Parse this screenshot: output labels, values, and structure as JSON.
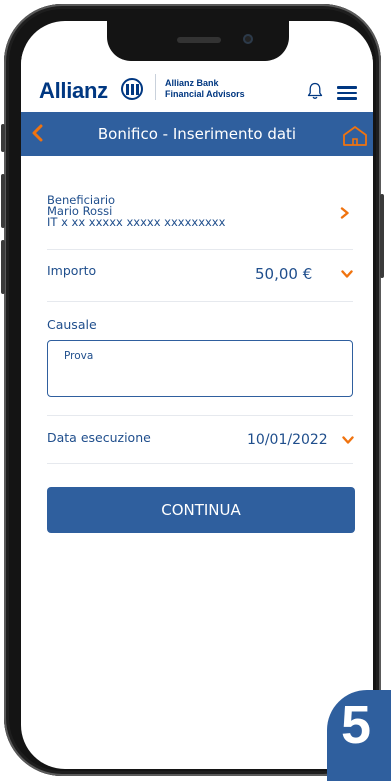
{
  "header": {
    "brand_name": "Allianz",
    "brand_line_1": "Allianz Bank",
    "brand_line_2": "Financial Advisors",
    "icons": [
      "allianz-logo-icon",
      "bell-icon",
      "hamburger-menu-icon"
    ]
  },
  "navbar": {
    "title": "Bonifico - Inserimento dati",
    "icons": [
      "back-chevron-icon",
      "home-icon"
    ]
  },
  "form": {
    "beneficiary": {
      "label": "Beneficiario",
      "name": "Mario Rossi",
      "iban": "IT x xx xxxxx xxxxx xxxxxxxxx"
    },
    "amount": {
      "label": "Importo",
      "value": "50,00 €"
    },
    "reason": {
      "label": "Causale",
      "value": "Prova"
    },
    "execution_date": {
      "label": "Data esecuzione",
      "value": "10/01/2022"
    },
    "continue_label": "CONTINUA"
  },
  "step_badge": "5",
  "colors": {
    "primary_blue": "#2f5f9e",
    "brand_blue": "#003781",
    "accent_orange": "#f0730f"
  }
}
